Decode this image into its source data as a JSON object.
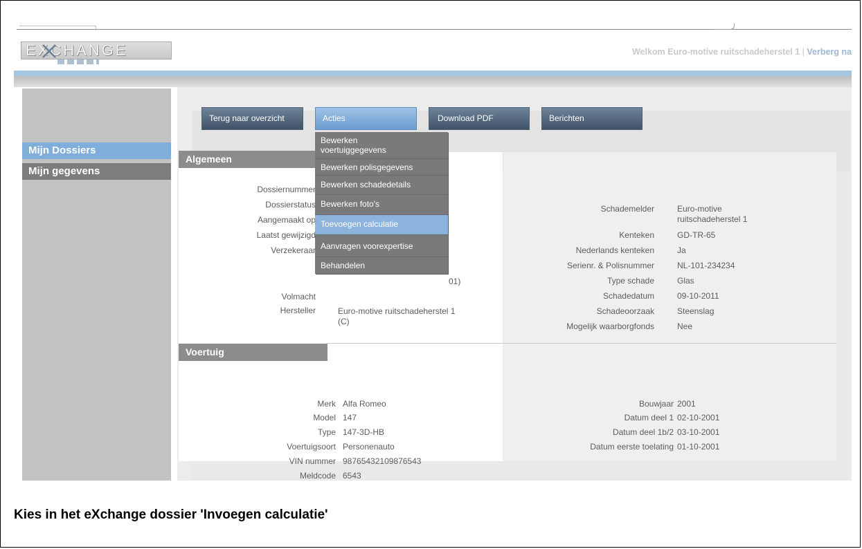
{
  "header": {
    "logo_text": "EXCHANGE",
    "welcome_text": "Welkom Euro-motive ruitschadeherstel 1",
    "separator": "|",
    "hide_link": "Verberg na"
  },
  "sidebar": {
    "items": [
      {
        "label": "Mijn Dossiers",
        "active": true
      },
      {
        "label": "Mijn gegevens",
        "active": false
      }
    ]
  },
  "toolbar": {
    "back_label": "Terug naar overzicht",
    "actions_label": "Acties",
    "pdf_label": "Download PDF",
    "messages_label": "Berichten"
  },
  "actions_menu": {
    "items": [
      {
        "label": "Bewerken voertuiggegevens"
      },
      {
        "label": "Bewerken polisgegevens"
      },
      {
        "label": "Bewerken schadedetails"
      },
      {
        "label": "Bewerken foto's"
      },
      {
        "label": "Toevoegen calculatie",
        "highlighted": true
      },
      {
        "label": "Aanvragen voorexpertise"
      },
      {
        "label": "Behandelen"
      }
    ]
  },
  "algemeen": {
    "title": "Algemeen",
    "left_labels": {
      "dossiernummer": "Dossiernummer",
      "dossierstatus": "Dossierstatus",
      "aangemaakt": "Aangemaakt op",
      "gewijzigd": "Laatst gewijzigd",
      "verzekeraar": "Verzekeraar",
      "volmacht": "Volmacht",
      "hersteller": "Hersteller"
    },
    "verzekeraar_partial": "01)",
    "hersteller_value": "Euro-motive ruitschadeherstel 1",
    "hersteller_value2": "(C)",
    "right": {
      "schademelder_label": "Schademelder",
      "schademelder_value": "Euro-motive",
      "schademelder_value2": "ruitschadeherstel 1",
      "kenteken_label": "Kenteken",
      "kenteken_value": "GD-TR-65",
      "nl_kenteken_label": "Nederlands kenteken",
      "nl_kenteken_value": "Ja",
      "serienr_label": "Serienr. & Polisnummer",
      "serienr_value": "NL-101-234234",
      "type_schade_label": "Type schade",
      "type_schade_value": "Glas",
      "schadedatum_label": "Schadedatum",
      "schadedatum_value": "09-10-2011",
      "oorzaak_label": "Schadeoorzaak",
      "oorzaak_value": "Steenslag",
      "waarborg_label": "Mogelijk waarborgfonds",
      "waarborg_value": "Nee"
    }
  },
  "voertuig": {
    "title": "Voertuig",
    "left": {
      "merk_label": "Merk",
      "merk_value": "Alfa Romeo",
      "model_label": "Model",
      "model_value": "147",
      "type_label": "Type",
      "type_value": "147-3D-HB",
      "soort_label": "Voertuigsoort",
      "soort_value": "Personenauto",
      "vin_label": "VIN nummer",
      "vin_value": "98765432109876543",
      "meldcode_label": "Meldcode",
      "meldcode_value": "6543"
    },
    "right": {
      "bouwjaar_label": "Bouwjaar",
      "bouwjaar_value": "2001",
      "deel1_label": "Datum deel 1",
      "deel1_value": "02-10-2001",
      "deel1b_label": "Datum deel 1b/2",
      "deel1b_value": "03-10-2001",
      "toelating_label": "Datum eerste toelating",
      "toelating_value": "01-10-2001"
    }
  },
  "caption": "Kies in het eXchange dossier 'Invoegen calculatie'",
  "colors": {
    "accent_blue": "#7faedb",
    "button_dark": "#4f6175",
    "menu_grey": "#7a7a7a"
  }
}
